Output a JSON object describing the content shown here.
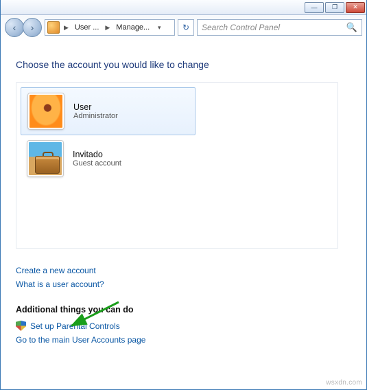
{
  "titlebar": {
    "minimize": "—",
    "maximize": "❐",
    "close": "✕"
  },
  "nav": {
    "back": "‹",
    "forward": "›"
  },
  "breadcrumb": {
    "seg1": "User ...",
    "seg2": "Manage..."
  },
  "refresh_glyph": "↻",
  "search": {
    "placeholder": "Search Control Panel",
    "mag": "🔍"
  },
  "heading": "Choose the account you would like to change",
  "accounts": [
    {
      "name": "User",
      "role": "Administrator"
    },
    {
      "name": "Invitado",
      "role": "Guest account"
    }
  ],
  "links": {
    "create": "Create a new account",
    "whatis": "What is a user account?"
  },
  "additional": {
    "heading": "Additional things you can do",
    "parental": "Set up Parental Controls",
    "gomain": "Go to the main User Accounts page"
  },
  "watermark": "wsxdn.com"
}
